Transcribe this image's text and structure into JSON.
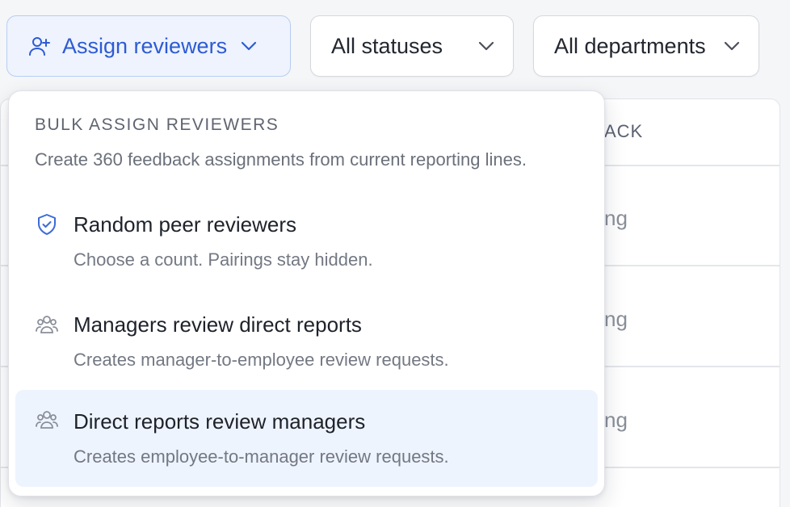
{
  "toolbar": {
    "assign_label": "Assign reviewers",
    "status_value": "All statuses",
    "department_value": "All departments"
  },
  "table": {
    "header_fragment": "ACK",
    "row_fragments": [
      "ng",
      "ng",
      "ng"
    ]
  },
  "menu": {
    "title": "BULK ASSIGN REVIEWERS",
    "subtitle": "Create 360 feedback assignments from current reporting lines.",
    "items": [
      {
        "label": "Random peer reviewers",
        "description": "Choose a count. Pairings stay hidden.",
        "icon": "shield-check-icon"
      },
      {
        "label": "Managers review direct reports",
        "description": "Creates manager-to-employee review requests.",
        "icon": "users-icon"
      },
      {
        "label": "Direct reports review managers",
        "description": "Creates employee-to-manager review requests.",
        "icon": "users-icon",
        "highlighted": true
      }
    ]
  },
  "colors": {
    "accent": "#2d5bd4",
    "accent_bg": "#eef3fd",
    "highlight_bg": "#eef4fd"
  }
}
